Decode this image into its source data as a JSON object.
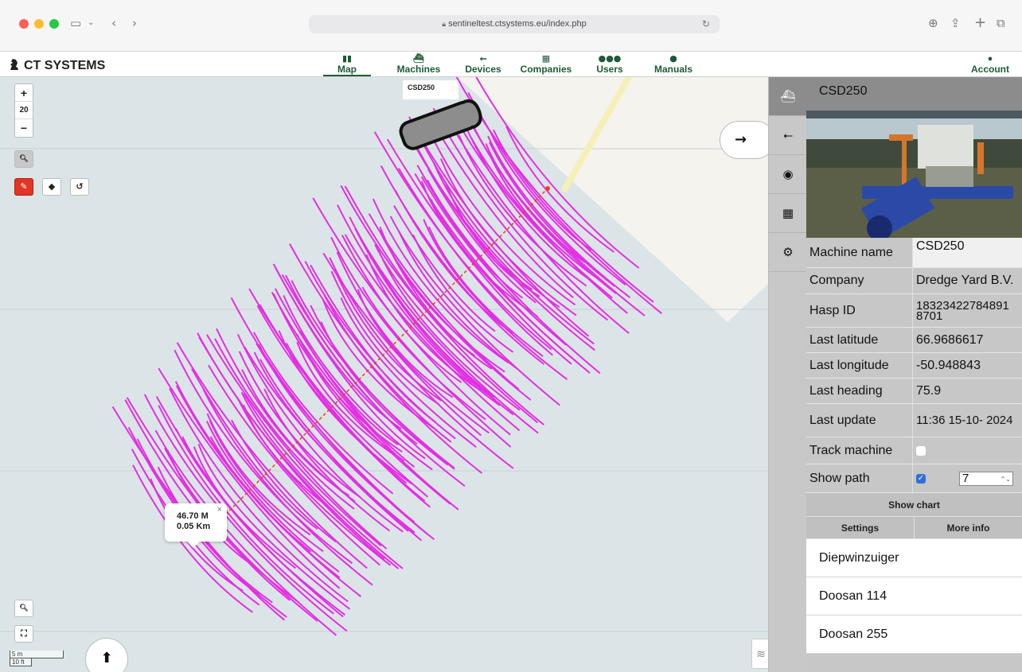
{
  "browser": {
    "url": "sentineltest.ctsystems.eu/index.php"
  },
  "header": {
    "logo": "CT SYSTEMS",
    "nav": [
      {
        "label": "Map",
        "icon": "map-icon"
      },
      {
        "label": "Machines",
        "icon": "ship-icon"
      },
      {
        "label": "Devices",
        "icon": "usb-icon"
      },
      {
        "label": "Companies",
        "icon": "building-icon"
      },
      {
        "label": "Users",
        "icon": "users-icon"
      },
      {
        "label": "Manuals",
        "icon": "info-icon"
      }
    ],
    "account": "Account"
  },
  "map": {
    "zoom_in": "+",
    "zoom_level": "20",
    "zoom_out": "−",
    "boat_label": "CSD250",
    "measure_popup": {
      "line1": "46.70 M",
      "line2": "0.05 Km",
      "close": "×"
    },
    "scale": {
      "metric": "5 m",
      "imperial": "10 ft"
    },
    "colors": {
      "water": "#dbe5e7",
      "land": "#f5f3ee",
      "path": "#e42ee4",
      "measure": "#e8401c"
    }
  },
  "strip": {
    "icons": [
      "ship-icon",
      "usb-icon",
      "eye-slash-icon",
      "building-icon",
      "gear-icon"
    ]
  },
  "panel": {
    "title": "CSD250",
    "rows": [
      {
        "key": "Machine name",
        "value": "CSD250"
      },
      {
        "key": "Company",
        "value": "Dredge Yard B.V."
      },
      {
        "key": "Hasp ID",
        "value": "18323422784891 8701"
      },
      {
        "key": "Last latitude",
        "value": "66.9686617"
      },
      {
        "key": "Last longitude",
        "value": "-50.948843"
      },
      {
        "key": "Last heading",
        "value": "75.9"
      },
      {
        "key": "Last update",
        "value": "11:36 15-10- 2024"
      },
      {
        "key": "Track machine",
        "value": ""
      },
      {
        "key": "Show path",
        "value": "7"
      }
    ],
    "show_chart": "Show chart",
    "settings": "Settings",
    "more_info": "More info",
    "machines": [
      "Diepwinzuiger",
      "Doosan 114",
      "Doosan 255"
    ]
  }
}
